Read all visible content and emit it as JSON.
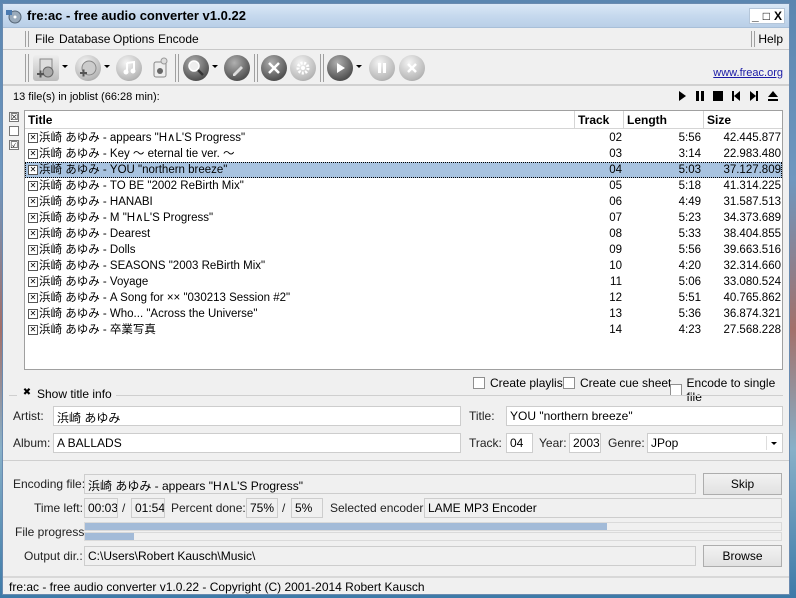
{
  "window": {
    "title": "fre:ac - free audio converter v1.0.22",
    "controls": {
      "minimize": "_",
      "maximize": "□",
      "close": "X"
    }
  },
  "menu": {
    "items": [
      "File",
      "Database",
      "Options",
      "Encode"
    ],
    "help": "Help"
  },
  "toolbar": {
    "buttons": [
      {
        "icon": "add-file-icon",
        "dropdown": true
      },
      {
        "icon": "add-cd-icon",
        "dropdown": true
      },
      {
        "icon": "music-note-icon",
        "dropdown": false
      },
      {
        "icon": "trash-icon",
        "dropdown": false
      },
      {
        "icon": "search-icon",
        "dropdown": true
      },
      {
        "icon": "cddb-edit-icon",
        "dropdown": false
      },
      {
        "icon": "tools-icon",
        "dropdown": false
      },
      {
        "icon": "settings-gear-icon",
        "dropdown": false
      },
      {
        "icon": "play-encode-icon",
        "dropdown": true
      },
      {
        "icon": "pause-icon",
        "dropdown": false
      },
      {
        "icon": "stop-icon",
        "dropdown": false
      }
    ],
    "link": "www.freac.org"
  },
  "joblist": {
    "summary": "13 file(s) in joblist (66:28 min):",
    "player_icons": [
      "play-icon",
      "pause-icon",
      "stop-icon",
      "previous-icon",
      "next-icon",
      "eject-icon"
    ],
    "side_checks": [
      "☒",
      "",
      "☑"
    ],
    "columns": [
      "Title",
      "Track",
      "Length",
      "Size"
    ],
    "rows": [
      {
        "title": "浜崎 あゆみ - appears \"H∧L'S Progress\"",
        "track": "02",
        "length": "5:56",
        "size": "42.445.877",
        "checked": true,
        "selected": false
      },
      {
        "title": "浜崎 あゆみ - Key 〜 eternal tie ver. 〜",
        "track": "03",
        "length": "3:14",
        "size": "22.983.480",
        "checked": true,
        "selected": false
      },
      {
        "title": "浜崎 あゆみ - YOU \"northern breeze\"",
        "track": "04",
        "length": "5:03",
        "size": "37.127.809",
        "checked": true,
        "selected": true
      },
      {
        "title": "浜崎 あゆみ - TO BE \"2002 ReBirth Mix\"",
        "track": "05",
        "length": "5:18",
        "size": "41.314.225",
        "checked": true,
        "selected": false
      },
      {
        "title": "浜崎 あゆみ - HANABI",
        "track": "06",
        "length": "4:49",
        "size": "31.587.513",
        "checked": true,
        "selected": false
      },
      {
        "title": "浜崎 あゆみ - M \"H∧L'S Progress\"",
        "track": "07",
        "length": "5:23",
        "size": "34.373.689",
        "checked": true,
        "selected": false
      },
      {
        "title": "浜崎 あゆみ - Dearest",
        "track": "08",
        "length": "5:33",
        "size": "38.404.855",
        "checked": true,
        "selected": false
      },
      {
        "title": "浜崎 あゆみ - Dolls",
        "track": "09",
        "length": "5:56",
        "size": "39.663.516",
        "checked": true,
        "selected": false
      },
      {
        "title": "浜崎 あゆみ - SEASONS \"2003 ReBirth Mix\"",
        "track": "10",
        "length": "4:20",
        "size": "32.314.660",
        "checked": true,
        "selected": false
      },
      {
        "title": "浜崎 あゆみ - Voyage",
        "track": "11",
        "length": "5:06",
        "size": "33.080.524",
        "checked": true,
        "selected": false
      },
      {
        "title": "浜崎 あゆみ - A Song for ×× \"030213 Session #2\"",
        "track": "12",
        "length": "5:51",
        "size": "40.765.862",
        "checked": true,
        "selected": false
      },
      {
        "title": "浜崎 あゆみ - Who... \"Across the Universe\"",
        "track": "13",
        "length": "5:36",
        "size": "36.874.321",
        "checked": true,
        "selected": false
      },
      {
        "title": "浜崎 あゆみ - 卒業写真",
        "track": "14",
        "length": "4:23",
        "size": "27.568.228",
        "checked": true,
        "selected": false
      }
    ]
  },
  "options": {
    "create_playlist": {
      "label": "Create playlist",
      "checked": false
    },
    "create_cue_sheet": {
      "label": "Create cue sheet",
      "checked": false
    },
    "encode_single": {
      "label": "Encode to single file",
      "checked": false
    }
  },
  "title_info": {
    "toggle_label": "Show title info",
    "toggle_checked": true,
    "artist_label": "Artist:",
    "artist": "浜崎 あゆみ",
    "title_label": "Title:",
    "title": "YOU \"northern breeze\"",
    "album_label": "Album:",
    "album": "A BALLADS",
    "track_label": "Track:",
    "track": "04",
    "year_label": "Year:",
    "year": "2003",
    "genre_label": "Genre:",
    "genre": "JPop"
  },
  "encoding": {
    "file_label": "Encoding file:",
    "file": "浜崎 あゆみ - appears \"H∧L'S Progress\"",
    "skip_label": "Skip",
    "time_left_label": "Time left:",
    "time_left_file": "00:03",
    "time_left_total": "01:54",
    "slash": "/",
    "percent_label": "Percent done:",
    "percent_file": "75%",
    "percent_total": "5%",
    "encoder_label": "Selected encoder:",
    "encoder": "LAME MP3 Encoder",
    "progress_label": "File progress:",
    "file_progress": 0.75,
    "total_progress": 0.07,
    "output_label": "Output dir.:",
    "output_dir": "C:\\Users\\Robert Kausch\\Music\\",
    "browse_label": "Browse"
  },
  "status": "fre:ac - free audio converter v1.0.22 - Copyright (C) 2001-2014 Robert Kausch",
  "colors": {
    "selection": "#a8c3e0",
    "progress_fill": "#a3bbd8",
    "link": "#1a1aa6"
  }
}
